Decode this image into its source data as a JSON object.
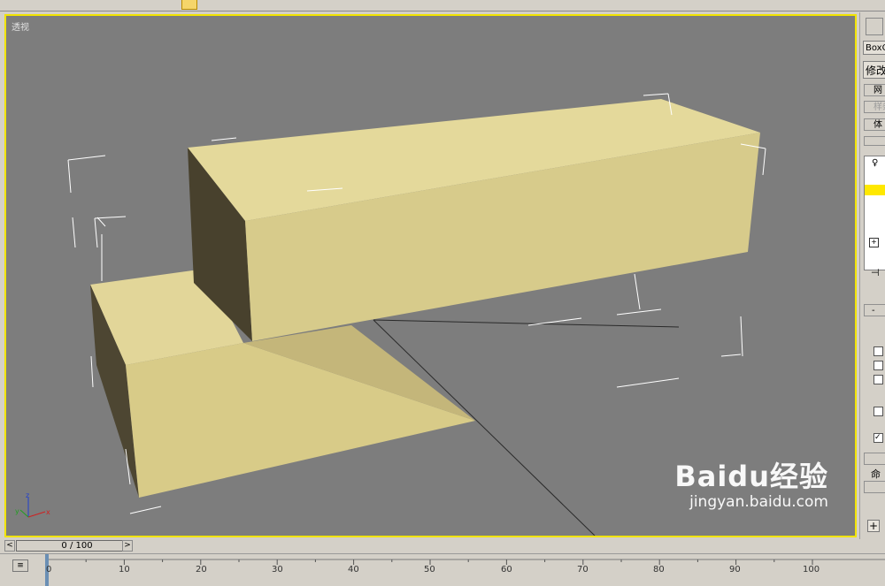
{
  "viewport": {
    "label": "透视"
  },
  "timeline": {
    "slider_text": "0 / 100",
    "prev": "<",
    "next": ">"
  },
  "ruler": {
    "ticks": [
      "0",
      "10",
      "20",
      "30",
      "40",
      "50",
      "60",
      "70",
      "80",
      "90",
      "100"
    ]
  },
  "command_panel": {
    "object_name": "BoxO",
    "modify_label": "修改",
    "btn1": "网",
    "btn2": "样条",
    "btn3": "体",
    "minus": "-",
    "command_label": "命令",
    "plus": "+"
  },
  "axis": {
    "z": "z",
    "x": "x",
    "y": "y"
  },
  "watermark": {
    "main": "Baidu经验",
    "sub": "jingyan.baidu.com"
  },
  "colors": {
    "viewport_bg": "#7d7d7d",
    "active_border": "#f1e400",
    "box_face": "#d9cd8c",
    "box_dark": "#4a4431"
  }
}
